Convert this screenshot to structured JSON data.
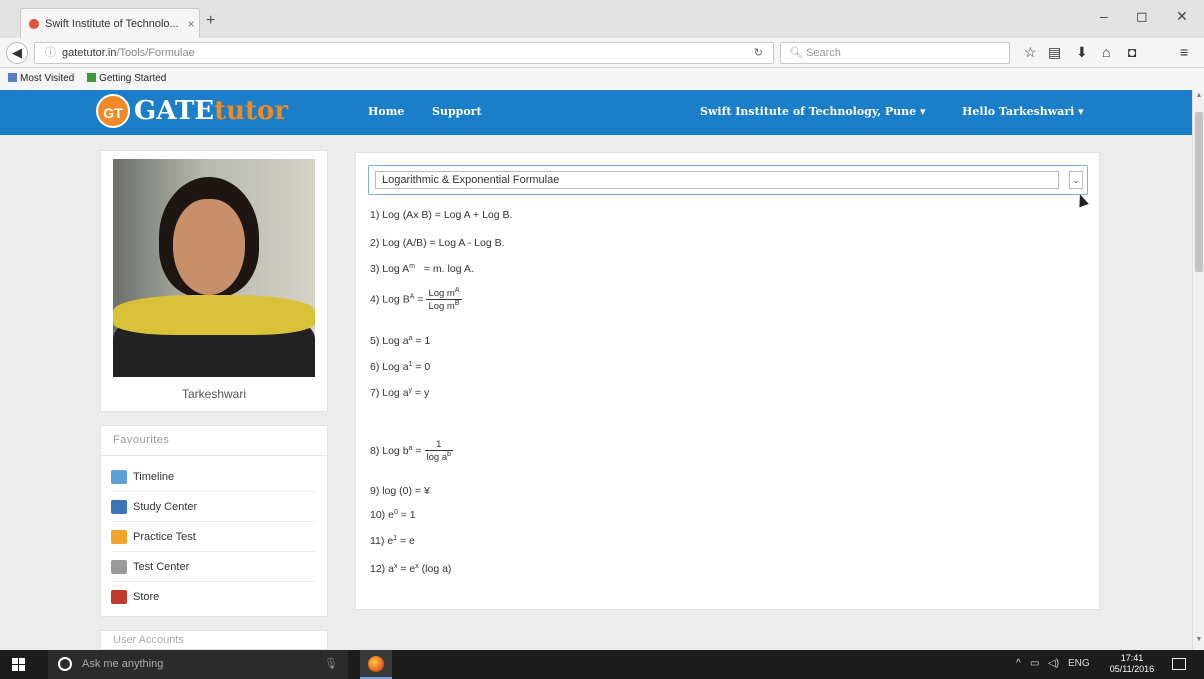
{
  "browser": {
    "tab_title": "Swift Institute of Technolo...",
    "tab_close": "×",
    "new_tab": "+",
    "url_domain": "gatetutor.in",
    "url_path": "/Tools/Formulae",
    "search_placeholder": "Search",
    "bookmarks": [
      "Most Visited",
      "Getting Started"
    ],
    "window_controls": [
      "–",
      "◻",
      "✕"
    ]
  },
  "header": {
    "logo_badge": "GT",
    "logo_word1": "GATE",
    "logo_word2": "tutor",
    "nav": [
      "Home",
      "Support"
    ],
    "institute": "Swift Institute of Technology, Pune ▾",
    "user": "Hello Tarkeshwari ▾",
    "brand_color": "#1a7ec8",
    "accent_color": "#f08a24"
  },
  "profile": {
    "name": "Tarkeshwari"
  },
  "favourites": {
    "title": "Favourites",
    "items": [
      {
        "label": "Timeline",
        "icon": "timeline-icon",
        "color": "#5ba1d8"
      },
      {
        "label": "Study Center",
        "icon": "study-center-icon",
        "color": "#3b74b8"
      },
      {
        "label": "Practice Test",
        "icon": "practice-test-icon",
        "color": "#f0a42a"
      },
      {
        "label": "Test Center",
        "icon": "test-center-icon",
        "color": "#9a9a9a"
      },
      {
        "label": "Store",
        "icon": "store-icon",
        "color": "#c0392b"
      }
    ]
  },
  "user_accounts": {
    "title": "User Accounts"
  },
  "formula_select": {
    "selected": "Logarithmic & Exponential Formulae",
    "arrow": "⌄"
  },
  "formulas": {
    "f1": "1) Log (Ax B) = Log A + Log B.",
    "f2": "2) Log (A/B) = Log A - Log B.",
    "f3_a": "3) Log A",
    "f3_sup": "m",
    "f3_b": " = m. log A.",
    "f4_a": "4) Log B",
    "f4_sup": "A",
    "f4_eq": " =",
    "f4_num": "Log m",
    "f4_num_sup": "A",
    "f4_den": "Log m",
    "f4_den_sup": "B",
    "f5_a": "5) Log a",
    "f5_sup": "a",
    "f5_b": " = 1",
    "f6_a": "6) Log a",
    "f6_sup": "1",
    "f6_b": " = 0",
    "f7_a": "7)  Log a",
    "f7_sup": "y",
    "f7_b": " = y",
    "f8_a": "8)  Log b",
    "f8_sup": "a",
    "f8_eq": " =",
    "f8_num": "1",
    "f8_den": "log a",
    "f8_den_sup": "b",
    "f9": "9) log (0) = ¥",
    "f10_a": "10) e",
    "f10_sup": "0",
    "f10_b": " = 1",
    "f11_a": "11) e",
    "f11_sup": "1",
    "f11_b": " = e",
    "f12_a": "12) a",
    "f12_sup": "x",
    "f12_b": " = e",
    "f12_sup2": "x",
    "f12_c": " (log a)"
  },
  "taskbar": {
    "search_placeholder": "Ask me anything",
    "lang": "ENG",
    "time": "17:41",
    "date": "05/11/2016"
  }
}
